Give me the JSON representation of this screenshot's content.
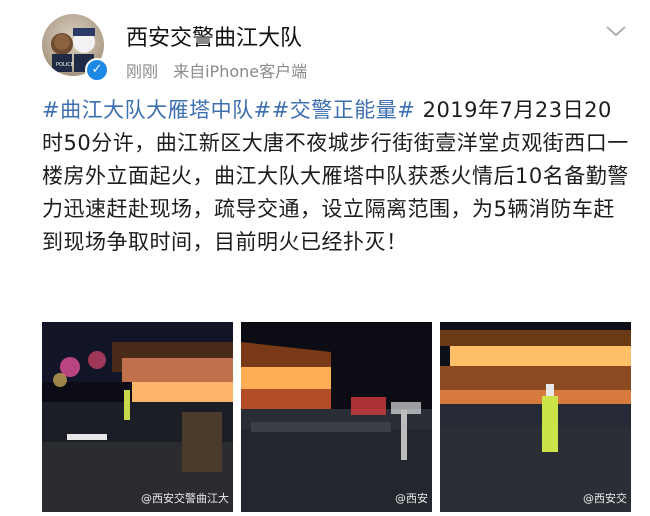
{
  "post": {
    "username": "西安交警曲江大队",
    "time": "刚刚",
    "source": "来自iPhone客户端",
    "hashtag1": "#曲江大队大雁塔中队#",
    "hashtag2": "#交警正能量#",
    "body": " 2019年7月23日20时50分许，曲江新区大唐不夜城步行街街壹洋堂贞观街西口一楼房外立面起火，曲江大队大雁塔中队获悉火情后10名备勤警力迅速赶赴现场，疏导交通，设立隔离范围，为5辆消防车赶到现场争取时间，目前明火已经扑灭！"
  },
  "photos": {
    "watermarks": [
      "@西安交警曲江大",
      "@西安",
      "@西安交"
    ]
  },
  "icons": {
    "verified": "verified-badge-icon",
    "menu": "chevron-down-icon"
  },
  "colors": {
    "hashtag": "#3e6fb1",
    "verified": "#1e88e5",
    "meta": "#8a8a8a"
  }
}
